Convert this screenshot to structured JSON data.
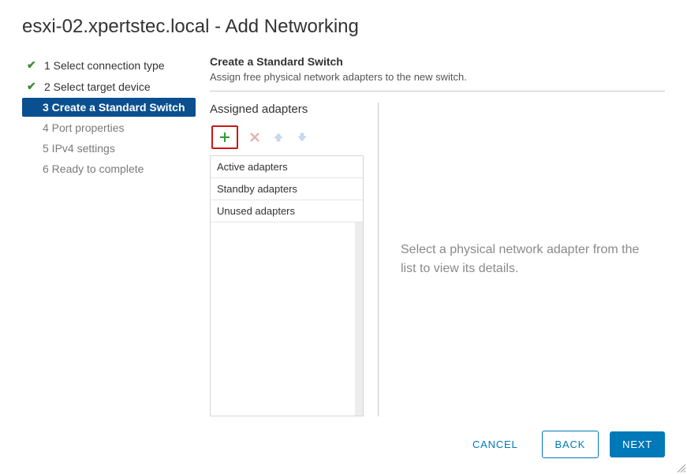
{
  "dialog": {
    "title": "esxi-02.xpertstec.local - Add Networking"
  },
  "wizard": {
    "steps": [
      {
        "label": "1 Select connection type",
        "state": "completed"
      },
      {
        "label": "2 Select target device",
        "state": "completed"
      },
      {
        "label": "3 Create a Standard Switch",
        "state": "current"
      },
      {
        "label": "4 Port properties",
        "state": "pending"
      },
      {
        "label": "5 IPv4 settings",
        "state": "pending"
      },
      {
        "label": "6 Ready to complete",
        "state": "pending"
      }
    ]
  },
  "panel": {
    "title": "Create a Standard Switch",
    "subtitle": "Assign free physical network adapters to the new switch."
  },
  "assigned": {
    "title": "Assigned adapters",
    "sections": {
      "active": "Active adapters",
      "standby": "Standby adapters",
      "unused": "Unused adapters"
    }
  },
  "toolbar_icons": {
    "add": "add-icon",
    "remove": "remove-icon",
    "up": "arrow-up-icon",
    "down": "arrow-down-icon"
  },
  "detail": {
    "placeholder": "Select a physical network adapter from the list to view its details."
  },
  "footer": {
    "cancel": "CANCEL",
    "back": "BACK",
    "next": "NEXT"
  }
}
